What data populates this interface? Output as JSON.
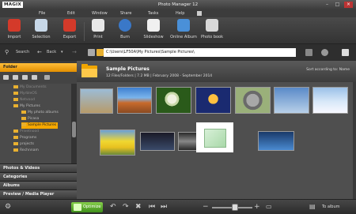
{
  "titlebar": {
    "logo": "MAGIX",
    "app_title": "Photo Manager 12",
    "minimize": "–",
    "maximize": "□",
    "close": "×"
  },
  "menu": [
    "File",
    "Edit",
    "Window",
    "Share",
    "Tasks",
    "Help"
  ],
  "toolbar": [
    {
      "label": "Import",
      "icon": "import-icon",
      "color": "#d43a2a"
    },
    {
      "label": "Selection",
      "icon": "selection-icon",
      "color": "#c8d8e8"
    },
    {
      "label": "Export",
      "icon": "export-icon",
      "color": "#d43a2a"
    },
    {
      "label": "Print",
      "icon": "print-icon",
      "color": "#e8e8e8"
    },
    {
      "label": "Burn",
      "icon": "burn-icon",
      "color": "#3a78c8"
    },
    {
      "label": "Slideshow",
      "icon": "slideshow-icon",
      "color": "#f0f0f0"
    },
    {
      "label": "Online Album",
      "icon": "online-album-icon",
      "color": "#4a90d8"
    },
    {
      "label": "Photo book",
      "icon": "photo-book-icon",
      "color": "#d8d8d8"
    }
  ],
  "nav": {
    "search": "Search",
    "back": "Back",
    "path": "C:\\Users\\LF50A\\My Pictures\\Sample Pictures\\"
  },
  "left": {
    "folder_tab": "Folder",
    "tree": [
      "My Documents",
      "MyrbleOS",
      "Netvood",
      "My Pictures",
      "My photo albums",
      "Picasa",
      "Sample Pictures",
      "Privetnood",
      "Programs",
      "projects",
      "Rechnnam"
    ],
    "sections": [
      "Photos & Videos",
      "Categories",
      "Albums",
      "Preview / Media Player"
    ]
  },
  "main": {
    "folder_title": "Sample Pictures",
    "folder_meta": "12 Files/Folders | 7.2 MB | February 2008 - September 2014",
    "sort_label": "Sort according to: Name"
  },
  "bottom": {
    "optimize": "Optimize",
    "to_album": "To album"
  }
}
